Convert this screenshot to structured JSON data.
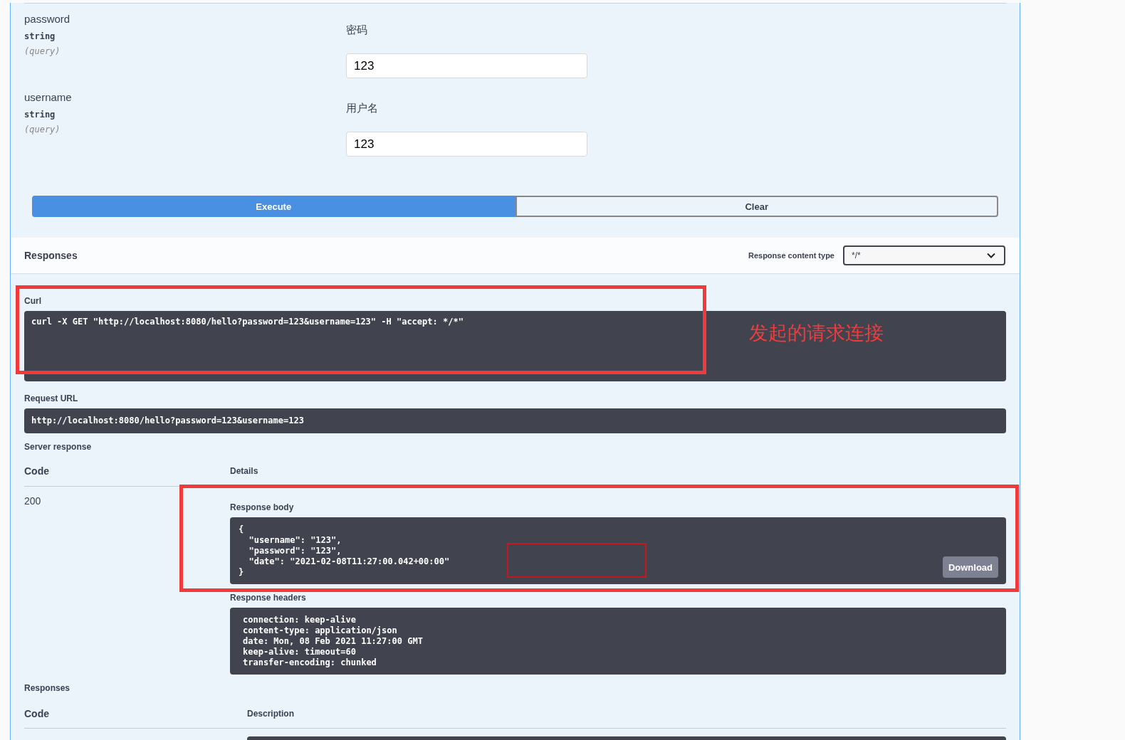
{
  "parameters": [
    {
      "name": "password",
      "type": "string",
      "location": "(query)",
      "description": "密码",
      "value": "123"
    },
    {
      "name": "username",
      "type": "string",
      "location": "(query)",
      "description": "用户名",
      "value": "123"
    }
  ],
  "buttons": [
    {
      "label": "Execute",
      "kind": "primary"
    },
    {
      "label": "Clear",
      "kind": "secondary"
    }
  ],
  "responses_bar": {
    "title": "Responses",
    "content_type_label": "Response content type",
    "content_type": "*/*"
  },
  "curl": {
    "label": "Curl",
    "command": "curl -X GET \"http://localhost:8080/hello?password=123&username=123\" -H \"accept: */*\"",
    "highlighted": true,
    "note": "发起的请求连接"
  },
  "request_url": {
    "label": "Request URL",
    "url": "http://localhost:8080/hello?password=123&username=123"
  },
  "server_response": {
    "title": "Server response",
    "columns": [
      "Code",
      "Details"
    ],
    "code": "200",
    "highlighted": true,
    "body": {
      "label": "Response body",
      "lines": [
        "{",
        "  \"username\": \"123\",",
        "  \"password\": \"123\",",
        "  \"date\": \"2021-02-08T11:27:00.042+00:00\"",
        "}"
      ],
      "marked": true,
      "download": "Download"
    },
    "headers": {
      "label": "Response headers",
      "lines": [
        "connection: keep-alive",
        "content-type: application/json",
        "date: Mon, 08 Feb 2021 11:27:00 GMT",
        "keep-alive: timeout=60",
        "transfer-encoding: chunked"
      ]
    }
  },
  "responses": {
    "title": "Responses",
    "columns": [
      "Code",
      "Description"
    ]
  }
}
